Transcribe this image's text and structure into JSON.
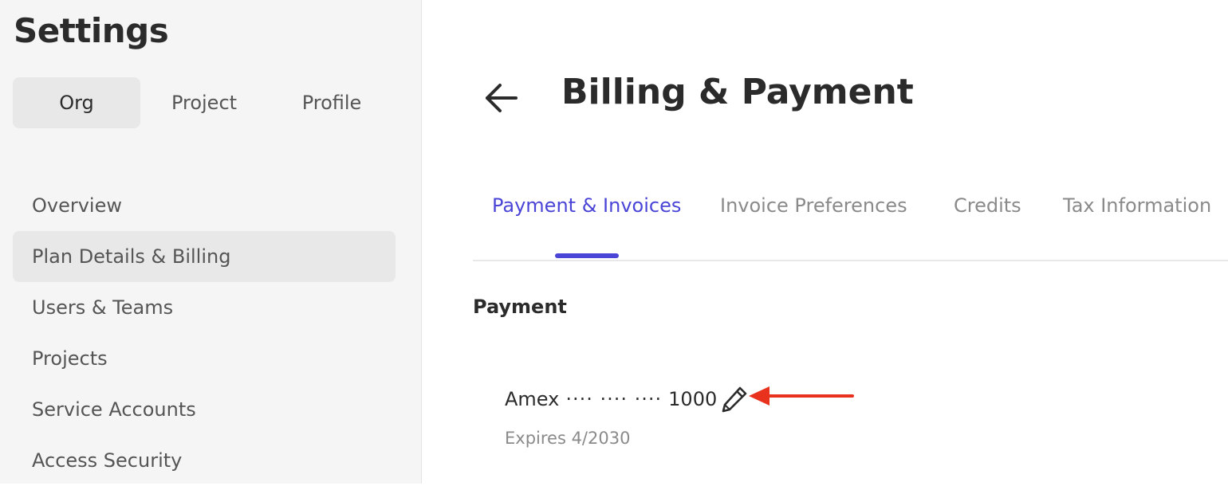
{
  "sidebar": {
    "title": "Settings",
    "scope_tabs": [
      {
        "label": "Org",
        "active": true
      },
      {
        "label": "Project",
        "active": false
      },
      {
        "label": "Profile",
        "active": false
      }
    ],
    "items": [
      {
        "label": "Overview",
        "active": false
      },
      {
        "label": "Plan Details & Billing",
        "active": true
      },
      {
        "label": "Users & Teams",
        "active": false
      },
      {
        "label": "Projects",
        "active": false
      },
      {
        "label": "Service Accounts",
        "active": false
      },
      {
        "label": "Access Security",
        "active": false
      }
    ]
  },
  "main": {
    "back_icon": "arrow-left-icon",
    "title": "Billing & Payment",
    "tabs": [
      {
        "label": "Payment & Invoices",
        "active": true
      },
      {
        "label": "Invoice Preferences",
        "active": false
      },
      {
        "label": "Credits",
        "active": false
      },
      {
        "label": "Tax Information",
        "active": false
      }
    ],
    "payment": {
      "section_title": "Payment",
      "card_brand": "Amex",
      "card_mask": "···· ···· ····",
      "card_last4": "1000",
      "expires": "Expires 4/2030",
      "edit_icon": "pencil-icon"
    }
  },
  "colors": {
    "accent": "#4a45d6",
    "annotation": "#e8321e",
    "sidebar_bg": "#f5f5f5",
    "active_bg": "#e8e8e8"
  }
}
